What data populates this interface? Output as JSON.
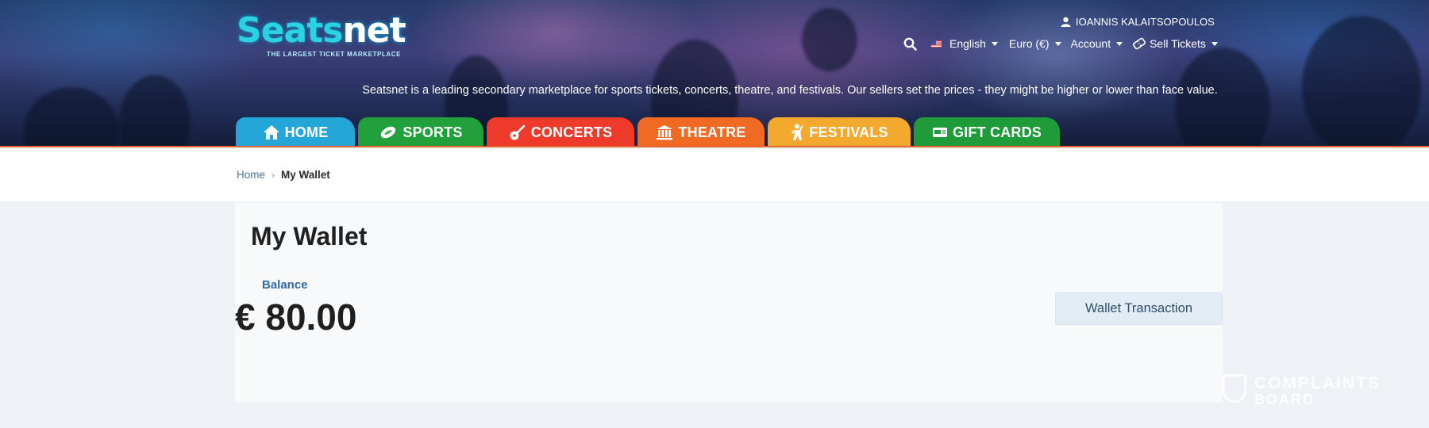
{
  "brand": {
    "name_part1": "Seats",
    "name_part2": "net",
    "tagline": "THE LARGEST TICKET MARKETPLACE",
    "accent_cyan": "#2ad3e0",
    "header_underline": "#e6652a"
  },
  "user": {
    "name": "IOANNIS KALAITSOPOULOS",
    "icon": "user-icon"
  },
  "top_nav": {
    "search_icon": "search-icon",
    "language": "English",
    "currency": "Euro (€)",
    "account": "Account",
    "sell": "Sell Tickets"
  },
  "banner_text": "Seatsnet is a leading secondary marketplace for sports tickets, concerts, theatre, and festivals. Our sellers set the prices - they might be higher or lower than face value.",
  "tabs": [
    {
      "label": "HOME",
      "color": "#24a6d8",
      "icon": "home-icon"
    },
    {
      "label": "SPORTS",
      "color": "#22a03c",
      "icon": "football-icon"
    },
    {
      "label": "CONCERTS",
      "color": "#ee3a2a",
      "icon": "guitar-icon"
    },
    {
      "label": "THEATRE",
      "color": "#f06a24",
      "icon": "theatre-icon"
    },
    {
      "label": "FESTIVALS",
      "color": "#f3a92e",
      "icon": "festival-icon"
    },
    {
      "label": "GIFT CARDS",
      "color": "#1f9b3a",
      "icon": "gift-card-icon"
    }
  ],
  "breadcrumb": {
    "home": "Home",
    "current": "My Wallet"
  },
  "page": {
    "title": "My Wallet",
    "balance_label": "Balance",
    "balance_value": "€ 80.00",
    "transaction_button": "Wallet Transaction"
  },
  "watermark": {
    "line1": "COMPLAINTS",
    "line2": "BOARD"
  }
}
